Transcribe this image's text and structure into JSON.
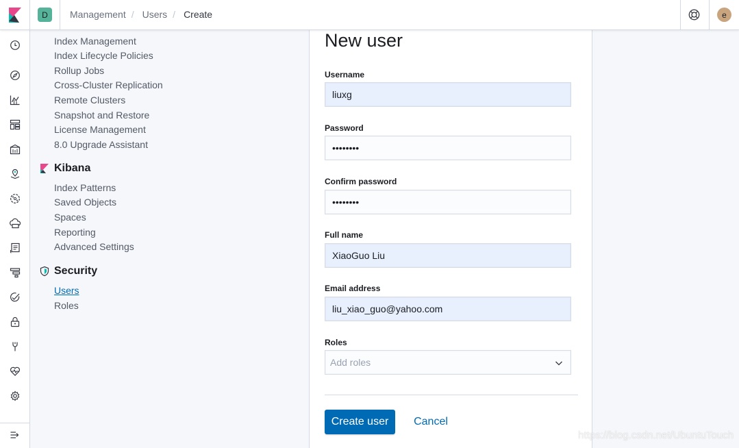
{
  "header": {
    "space_initial": "D",
    "breadcrumbs": [
      "Management",
      "Users",
      "Create"
    ],
    "avatar_initial": "e"
  },
  "navbar": {
    "icons": [
      "clock-icon",
      "compass-icon",
      "visualize-icon",
      "dashboard-icon",
      "canvas-icon",
      "maps-icon",
      "ml-icon",
      "infrastructure-icon",
      "logs-icon",
      "apm-icon",
      "uptime-icon",
      "siem-icon",
      "devtools-icon",
      "monitoring-icon",
      "management-icon"
    ],
    "dock_icon": "dock-toggle-icon"
  },
  "sidebar": {
    "elasticsearch_items": [
      "Index Management",
      "Index Lifecycle Policies",
      "Rollup Jobs",
      "Cross-Cluster Replication",
      "Remote Clusters",
      "Snapshot and Restore",
      "License Management",
      "8.0 Upgrade Assistant"
    ],
    "kibana": {
      "title": "Kibana",
      "items": [
        "Index Patterns",
        "Saved Objects",
        "Spaces",
        "Reporting",
        "Advanced Settings"
      ]
    },
    "security": {
      "title": "Security",
      "items": [
        "Users",
        "Roles"
      ],
      "selected": "Users"
    }
  },
  "form": {
    "title": "New user",
    "username": {
      "label": "Username",
      "value": "liuxg"
    },
    "password": {
      "label": "Password",
      "value": "••••••••"
    },
    "confirm_password": {
      "label": "Confirm password",
      "value": "••••••••"
    },
    "full_name": {
      "label": "Full name",
      "value": "XiaoGuo Liu"
    },
    "email": {
      "label": "Email address",
      "value": "liu_xiao_guo@yahoo.com"
    },
    "roles": {
      "label": "Roles",
      "placeholder": "Add roles"
    },
    "submit_label": "Create user",
    "cancel_label": "Cancel"
  },
  "watermark": "https://blog.csdn.net/UbuntuTouch",
  "colors": {
    "primary": "#006bb4",
    "autofill": "#e8f0fe",
    "space_badge": "#54b399",
    "avatar": "#c8a57e"
  }
}
